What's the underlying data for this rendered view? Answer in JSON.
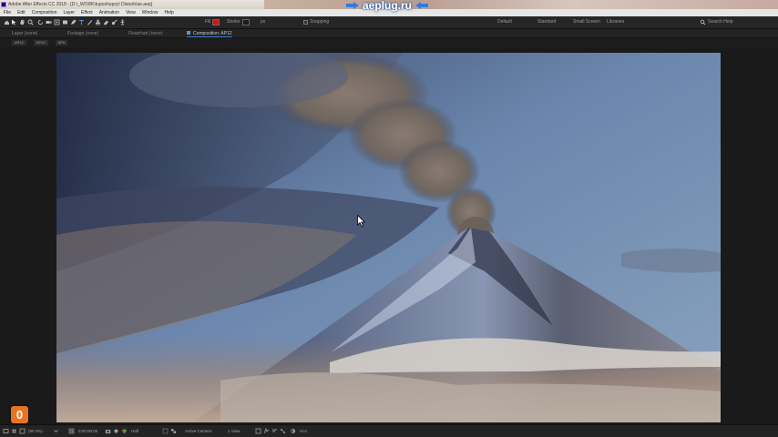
{
  "window": {
    "title": "Adobe After Effects CC 2018 - [D:\\_WORK\\tuposhupsy\\ Disturb\\ae.aep]"
  },
  "watermark": {
    "text": "aeplug.ru"
  },
  "menu": {
    "items": [
      "File",
      "Edit",
      "Composition",
      "Layer",
      "Effect",
      "Animation",
      "View",
      "Window",
      "Help"
    ]
  },
  "toolbar": {
    "fill_label": "Fill",
    "stroke_label": "Stroke",
    "stroke_width": "px",
    "snapping_label": "Snapping",
    "fill_color": "#e31010",
    "workspaces": [
      "Default",
      "Standard",
      "Small Screen",
      "Libraries"
    ],
    "search_placeholder": "Search Help"
  },
  "panels": {
    "tabs": [
      "Layer (none)",
      "Footage (none)",
      "Flowchart (none)",
      "Composition: AP12"
    ]
  },
  "breadcrumb": {
    "items": [
      "AP12",
      "AP10",
      "AP9"
    ]
  },
  "statusbar": {
    "zoom": "(90.4%)",
    "timecode": "0;00;00;00",
    "resolution": "Half",
    "view": "Active Camera",
    "views": "1 View",
    "exposure": "+0.0"
  },
  "badge": {
    "text": "0"
  }
}
